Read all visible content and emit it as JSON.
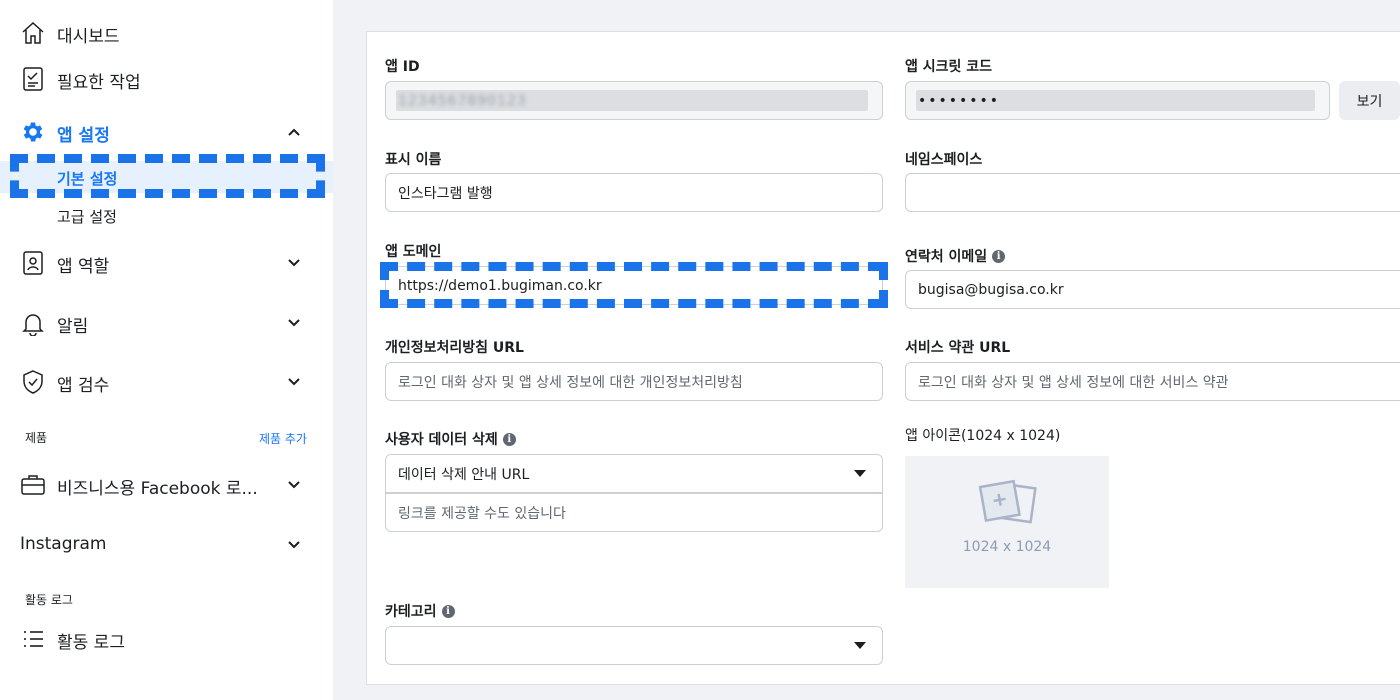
{
  "sidebar": {
    "items": [
      {
        "label": "대시보드",
        "icon": "home-icon"
      },
      {
        "label": "필요한 작업",
        "icon": "checklist-icon"
      },
      {
        "label": "앱 설정",
        "icon": "gear-icon",
        "active": true
      },
      {
        "label": "앱 역할",
        "icon": "id-badge-icon"
      },
      {
        "label": "알림",
        "icon": "bell-icon"
      },
      {
        "label": "앱 검수",
        "icon": "shield-check-icon"
      }
    ],
    "sub_items": [
      "기본 설정",
      "고급 설정"
    ],
    "products_label": "제품",
    "add_product": "제품 추가",
    "product_items": [
      "비즈니스용 Facebook 로...",
      "Instagram"
    ],
    "activity_section_label": "활동 로그",
    "activity_item": "활동 로그"
  },
  "form": {
    "app_id_label": "앱 ID",
    "app_id_value": "1234567890123",
    "app_secret_label": "앱 시크릿 코드",
    "app_secret_value": "••••••••",
    "show_button": "보기",
    "display_name_label": "표시 이름",
    "display_name_value": "인스타그램 발행",
    "namespace_label": "네임스페이스",
    "namespace_value": "",
    "app_domain_label": "앱 도메인",
    "app_domain_value": "https://demo1.bugiman.co.kr",
    "contact_email_label": "연락처 이메일",
    "contact_email_value": "bugisa@bugisa.co.kr",
    "privacy_url_label": "개인정보처리방침 URL",
    "privacy_url_placeholder": "로그인 대화 상자 및 앱 상세 정보에 대한 개인정보처리방침",
    "terms_url_label": "서비스 약관 URL",
    "terms_url_placeholder": "로그인 대화 상자 및 앱 상세 정보에 대한 서비스 약관",
    "user_data_deletion_label": "사용자 데이터 삭제",
    "user_data_deletion_select": "데이터 삭제 안내 URL",
    "user_data_deletion_placeholder": "링크를 제공할 수도 있습니다",
    "app_icon_label": "앱 아이콘(1024 x 1024)",
    "app_icon_size": "1024 x 1024",
    "category_label": "카테고리",
    "category_value": ""
  },
  "colors": {
    "accent": "#1877f2",
    "highlight_dash": "#1a73e8",
    "active_bg": "#e7f0fd"
  }
}
